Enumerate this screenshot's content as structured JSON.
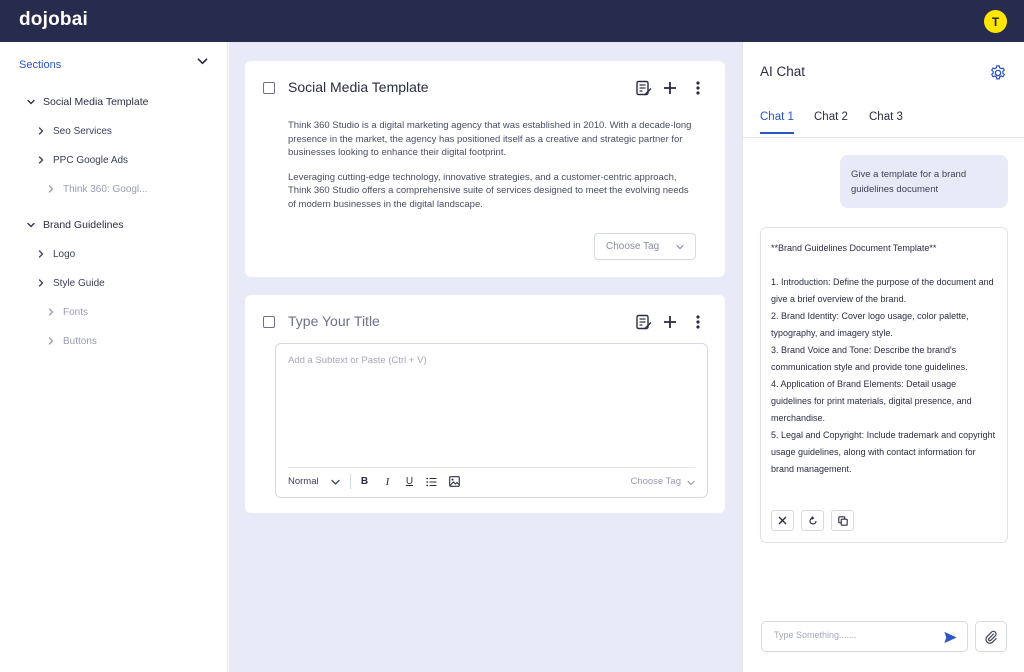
{
  "app": {
    "logo": "dojobai",
    "avatar_initial": "T"
  },
  "colors": {
    "topbar": "#272b4d",
    "accent": "#2b54c4",
    "avatar": "#ffe600",
    "workspace_bg": "#e8ebf7"
  },
  "sidebar": {
    "heading": "Sections",
    "items": [
      {
        "label": "Social Media Template",
        "level": 1,
        "expanded": true
      },
      {
        "label": "Seo Services",
        "level": 2
      },
      {
        "label": "PPC Google Ads",
        "level": 2
      },
      {
        "label": "Think 360: Googl...",
        "level": 3
      },
      {
        "label": "Brand Guidelines",
        "level": 1,
        "expanded": true
      },
      {
        "label": "Logo",
        "level": 2
      },
      {
        "label": "Style Guide",
        "level": 2
      },
      {
        "label": "Fonts",
        "level": 3
      },
      {
        "label": "Buttons",
        "level": 3
      }
    ]
  },
  "cards": [
    {
      "title": "Social Media Template",
      "paragraphs": [
        "Think 360 Studio is a digital marketing agency that was established in 2010. With a decade-long presence in the market, the agency has positioned itself as a creative and strategic partner for businesses looking to enhance their digital footprint.",
        "Leveraging cutting-edge technology, innovative strategies, and a customer-centric approach, Think 360 Studio offers a comprehensive suite of services designed to meet the evolving needs of modern businesses in the digital landscape."
      ],
      "tag_placeholder": "Choose Tag"
    },
    {
      "title_placeholder": "Type Your Title",
      "editor_placeholder": "Add a Subtext or Paste (Ctrl + V)",
      "format_label": "Normal",
      "tag_placeholder": "Choose Tag",
      "toolbar_icons": [
        "bold-icon",
        "italic-icon",
        "underline-icon",
        "bullet-list-icon",
        "image-icon"
      ]
    }
  ],
  "chat": {
    "title": "AI Chat",
    "tabs": [
      {
        "label": "Chat 1",
        "active": true
      },
      {
        "label": "Chat 2",
        "active": false
      },
      {
        "label": "Chat 3",
        "active": false
      }
    ],
    "user_message": "Give a template for a brand guidelines document",
    "ai_heading": "**Brand Guidelines Document Template**",
    "ai_items": [
      "1. Introduction: Define the purpose of the document and give a brief overview of the brand.",
      "2. Brand Identity: Cover logo usage, color palette, typography, and imagery style.",
      "3. Brand Voice and Tone: Describe the brand's communication style and provide tone guidelines.",
      "4. Application of Brand Elements: Detail usage guidelines for print materials, digital presence, and merchandise.",
      "5. Legal and Copyright: Include trademark and copyright usage guidelines, along with contact information for brand management."
    ],
    "input_placeholder": "Type Something......."
  }
}
